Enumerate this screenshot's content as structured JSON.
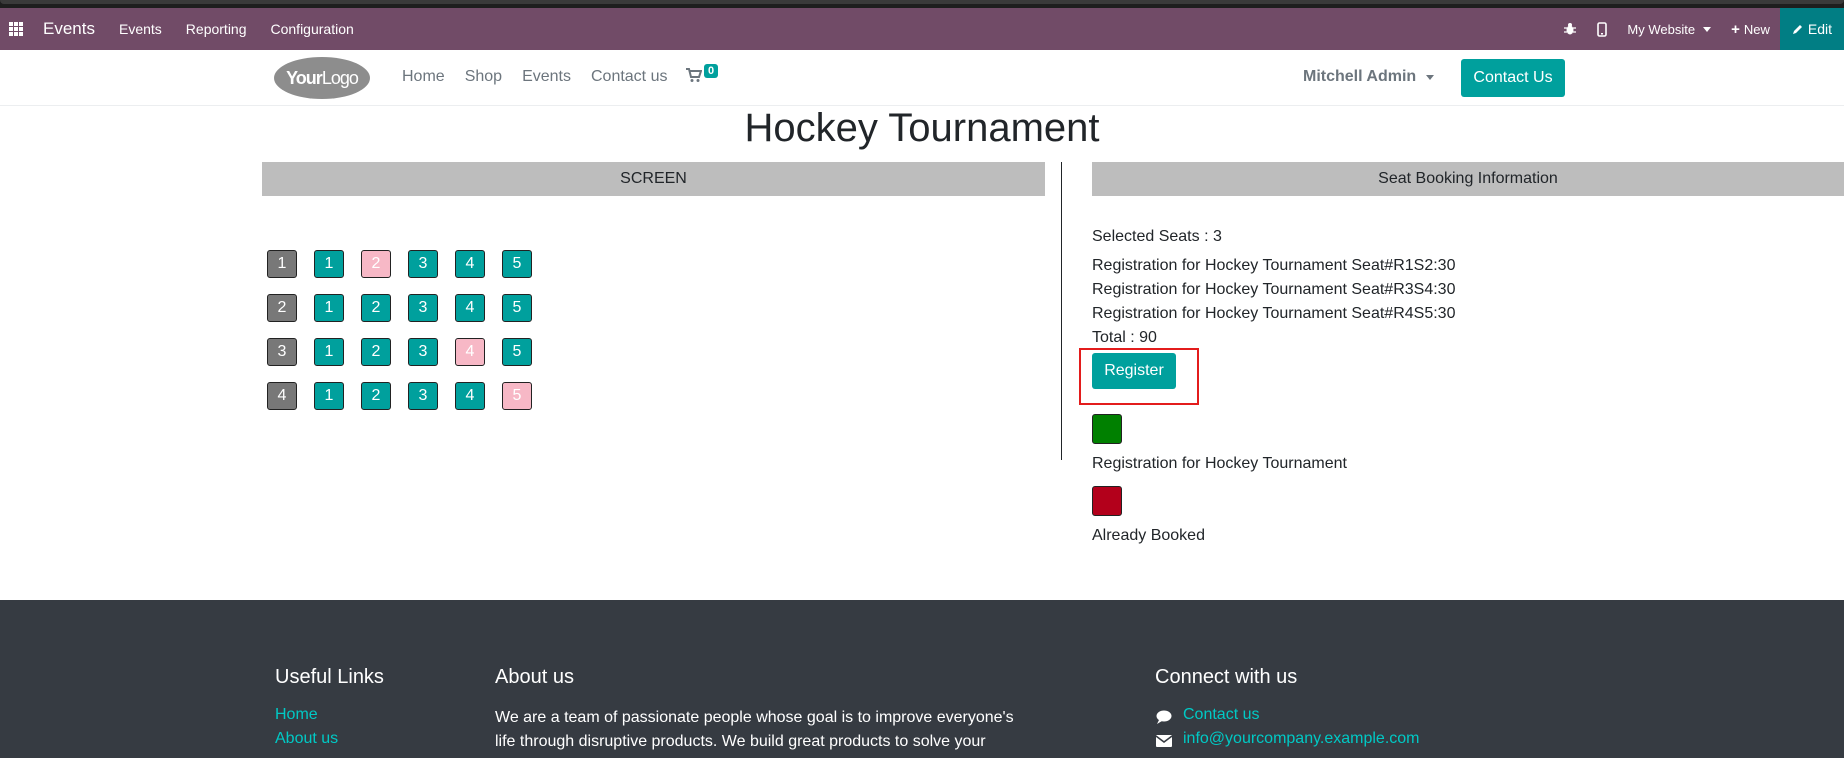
{
  "odoo_bar": {
    "app_name": "Events",
    "menus": [
      "Events",
      "Reporting",
      "Configuration"
    ],
    "website_selector": "My Website",
    "new_label": "New",
    "edit_label": "Edit"
  },
  "site": {
    "logo_bold": "Your",
    "logo_light": "Logo",
    "nav": [
      "Home",
      "Shop",
      "Events",
      "Contact us"
    ],
    "cart_count": "0",
    "user": "Mitchell Admin",
    "contact_button": "Contact Us"
  },
  "event": {
    "title": "Hockey Tournament",
    "screen_label": "SCREEN",
    "info_header": "Seat Booking Information"
  },
  "seat_rows": [
    {
      "label": "1",
      "seats": [
        {
          "n": "1",
          "state": "avail"
        },
        {
          "n": "2",
          "state": "selected"
        },
        {
          "n": "3",
          "state": "avail"
        },
        {
          "n": "4",
          "state": "avail"
        },
        {
          "n": "5",
          "state": "avail"
        }
      ]
    },
    {
      "label": "2",
      "seats": [
        {
          "n": "1",
          "state": "avail"
        },
        {
          "n": "2",
          "state": "avail"
        },
        {
          "n": "3",
          "state": "avail"
        },
        {
          "n": "4",
          "state": "avail"
        },
        {
          "n": "5",
          "state": "avail"
        }
      ]
    },
    {
      "label": "3",
      "seats": [
        {
          "n": "1",
          "state": "avail"
        },
        {
          "n": "2",
          "state": "avail"
        },
        {
          "n": "3",
          "state": "avail"
        },
        {
          "n": "4",
          "state": "selected"
        },
        {
          "n": "5",
          "state": "avail"
        }
      ]
    },
    {
      "label": "4",
      "seats": [
        {
          "n": "1",
          "state": "avail"
        },
        {
          "n": "2",
          "state": "avail"
        },
        {
          "n": "3",
          "state": "avail"
        },
        {
          "n": "4",
          "state": "avail"
        },
        {
          "n": "5",
          "state": "selected"
        }
      ]
    }
  ],
  "booking": {
    "selected_seats": "Selected Seats : 3",
    "registrations": [
      "Registration for Hockey Tournament Seat#R1S2:30",
      "Registration for Hockey Tournament Seat#R3S4:30",
      "Registration for Hockey Tournament Seat#R4S5:30"
    ],
    "total": "Total : 90",
    "register_label": "Register",
    "legend_available": "Registration for Hockey Tournament",
    "legend_booked": "Already Booked"
  },
  "colors": {
    "odoo_purple": "#714b67",
    "teal": "#00a09d",
    "selected_pink": "#f7b8c6",
    "available_green": "#008000",
    "booked_red": "#b3001b"
  },
  "footer": {
    "useful_links_title": "Useful Links",
    "useful_links": [
      "Home",
      "About us"
    ],
    "about_title": "About us",
    "about_text": "We are a team of passionate people whose goal is to improve everyone's life through disruptive products. We build great products to solve your",
    "connect_title": "Connect with us",
    "connect_items": [
      "Contact us",
      "info@yourcompany.example.com"
    ]
  }
}
